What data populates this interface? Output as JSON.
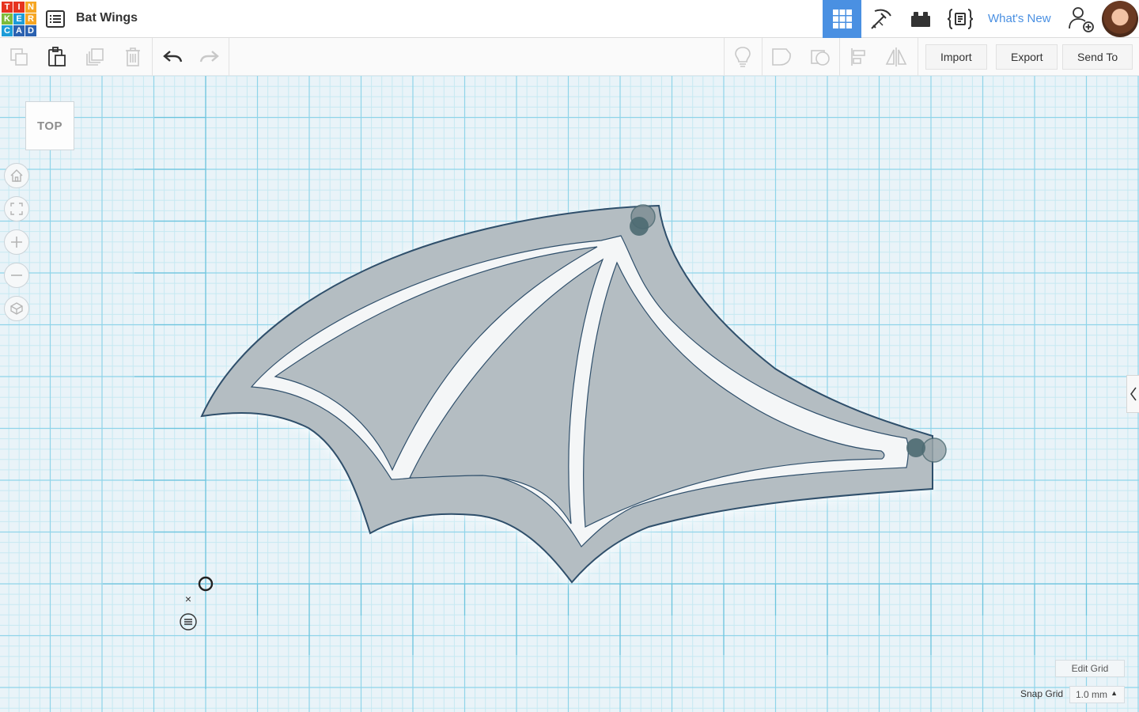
{
  "app": {
    "logo_letters": [
      "T",
      "I",
      "N",
      "K",
      "E",
      "R",
      "C",
      "A",
      "D"
    ],
    "logo_colors": [
      "#e6331f",
      "#e6331f",
      "#f6a623",
      "#7dbb3a",
      "#1c9cd8",
      "#f6a623",
      "#1c9cd8",
      "#2a61b0",
      "#2a61b0"
    ],
    "design_title": "Bat Wings",
    "whats_new_label": "What's New",
    "accent_color": "#4a90e2"
  },
  "header": {
    "buttons": [
      "design-list-icon",
      "3d-view-grid-icon",
      "pickaxe-icon",
      "bricks-icon",
      "codeblocks-icon",
      "invite-user-icon",
      "user-avatar"
    ]
  },
  "toolbar": {
    "import_label": "Import",
    "export_label": "Export",
    "send_to_label": "Send To",
    "left_tools": [
      "copy-icon",
      "paste-icon",
      "duplicate-icon",
      "delete-icon",
      "undo-icon",
      "redo-icon"
    ],
    "right_tools": [
      "light-bulb-icon",
      "note-icon",
      "workplane-icon",
      "align-icon",
      "mirror-icon"
    ]
  },
  "viewport": {
    "view_cube_label": "TOP",
    "nav_controls": [
      "home-icon",
      "fit-view-icon",
      "zoom-in-icon",
      "zoom-out-icon",
      "perspective-icon"
    ],
    "edit_grid_label": "Edit Grid",
    "snap_grid_label": "Snap Grid",
    "snap_grid_value": "1.0 mm",
    "close_symbol": "×",
    "grid_colors": {
      "minor": "#c7e9f2",
      "major": "#8fd4e9",
      "background": "#e9f3f8"
    },
    "shape_colors": {
      "fill": "#b4bdc2",
      "outline": "#2f4f6b",
      "cutout": "#f4f6f7",
      "pin": "#4d6a72"
    }
  }
}
